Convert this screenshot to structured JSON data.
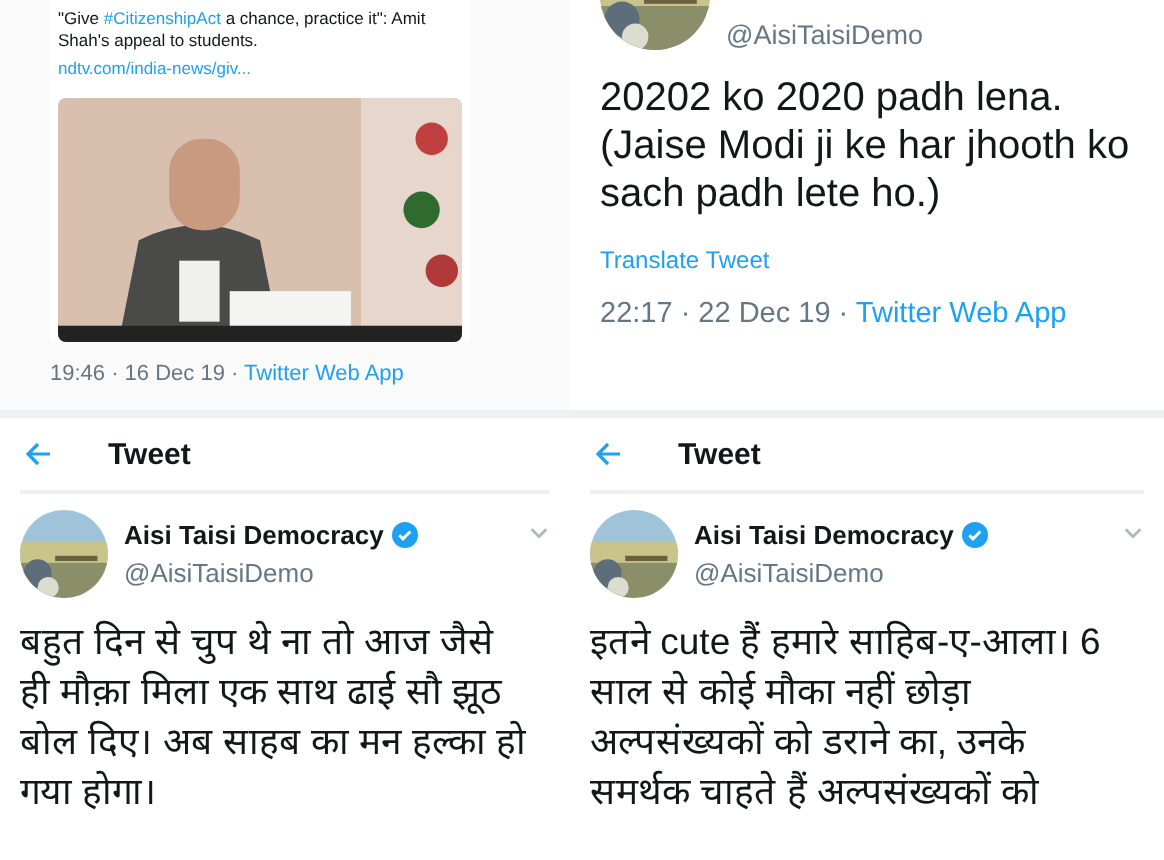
{
  "panels": [
    {
      "kind": "link_card",
      "quote": [
        {
          "kind": "plain",
          "text": "\"Give "
        },
        {
          "kind": "hashtag",
          "text": "#CitizenshipAct"
        },
        {
          "kind": "plain",
          "text": " a chance, practice it\": Amit Shah's appeal to students."
        }
      ],
      "link": "ndtv.com/india-news/giv...",
      "media": {
        "kind": "picture"
      },
      "time": "19:46 · 16 Dec 19 ·",
      "source": "Twitter Web App"
    },
    {
      "kind": "tweet_tail",
      "handle": "@AisiTaisiDemo",
      "text": "20202 ko 2020 padh lena. (Jaise Modi ji ke har jhooth ko sach padh lete ho.)",
      "translate": "Translate Tweet",
      "time": "22:17 · 22 Dec 19 ·",
      "source": "Twitter Web App"
    },
    {
      "kind": "tweet_head",
      "header": "Tweet",
      "name": "Aisi Taisi Democracy",
      "verified": true,
      "handle": "@AisiTaisiDemo",
      "text": "बहुत दिन से चुप थे ना तो आज जैसे ही मौक़ा मिला एक साथ ढाई सौ झूठ बोल दिए। अब साहब का मन हल्का हो गया होगा।"
    },
    {
      "kind": "tweet_head",
      "header": "Tweet",
      "name": "Aisi Taisi Democracy",
      "verified": true,
      "handle": "@AisiTaisiDemo",
      "text": "इतने cute हैं हमारे साहिब-ए-आला। 6 साल से कोई मौका नहीं छोड़ा अल्पसंख्यकों को डराने का, उनके समर्थक चाहते हैं अल्पसंख्यकों को"
    }
  ]
}
